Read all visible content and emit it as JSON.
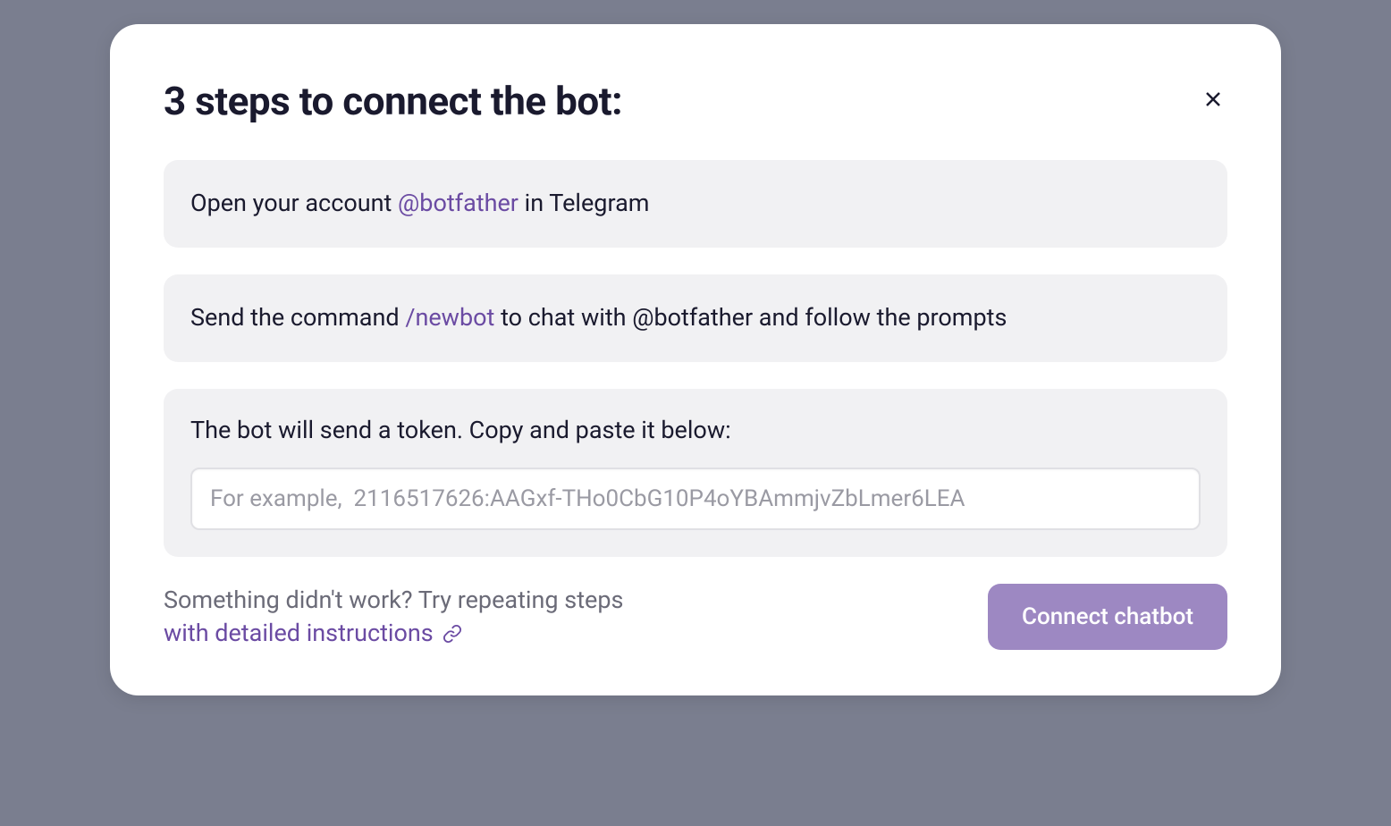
{
  "modal": {
    "title": "3 steps to connect the bot:",
    "step1": {
      "prefix": "Open your account ",
      "highlight": "@botfather",
      "suffix": " in Telegram"
    },
    "step2": {
      "prefix": "Send the command ",
      "highlight": "/newbot",
      "suffix": " to chat with @botfather and follow the prompts"
    },
    "step3": {
      "text": "The bot will send a token. Copy and paste it below:",
      "placeholder": "For example,  2116517626:AAGxf-THo0CbG10P4oYBAmmjvZbLmer6LEA"
    },
    "footer": {
      "help_prefix": "Something didn't work? Try repeating steps ",
      "help_link": "with detailed instructions",
      "connect_label": "Connect chatbot"
    }
  }
}
